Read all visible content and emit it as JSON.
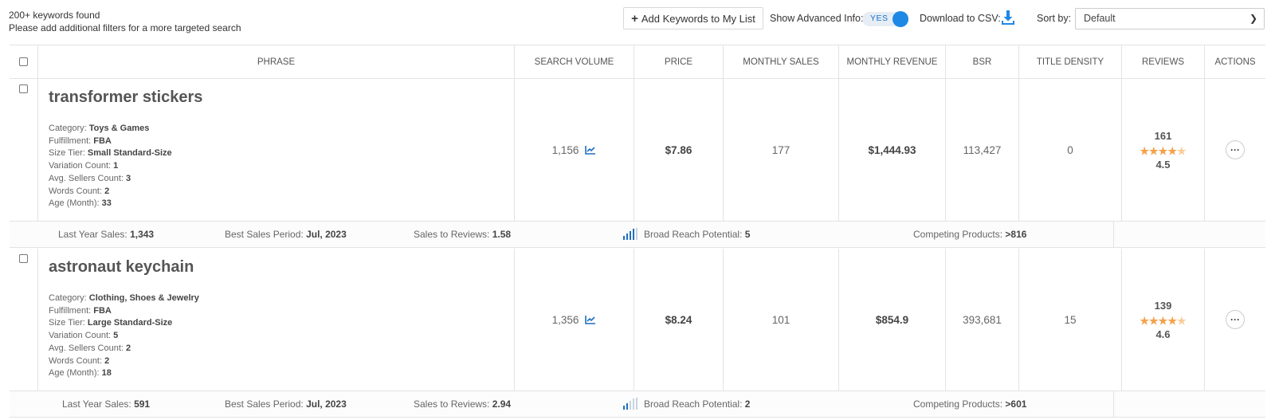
{
  "topbar": {
    "found_line1": "200+ keywords found",
    "found_line2": "Please add additional filters for a more targeted search",
    "add_button": "Add Keywords to My List",
    "advanced_label": "Show Advanced Info:",
    "advanced_toggle": "YES",
    "csv_label": "Download to CSV:",
    "sort_label": "Sort by:",
    "sort_value": "Default"
  },
  "columns": {
    "phrase": "PHRASE",
    "search_volume": "SEARCH VOLUME",
    "price": "PRICE",
    "monthly_sales": "MONTHLY SALES",
    "monthly_revenue": "MONTHLY REVENUE",
    "bsr": "BSR",
    "title_density": "TITLE DENSITY",
    "reviews": "REVIEWS",
    "actions": "ACTIONS"
  },
  "labels": {
    "category": "Category:",
    "fulfillment": "Fulfillment:",
    "size_tier": "Size Tier:",
    "variation_count": "Variation Count:",
    "avg_sellers": "Avg. Sellers Count:",
    "words_count": "Words Count:",
    "age": "Age (Month):",
    "last_year_sales": "Last Year Sales:",
    "best_sales_period": "Best Sales Period:",
    "sales_to_reviews": "Sales to Reviews:",
    "broad_reach": "Broad Reach Potential:",
    "competing": "Competing Products:"
  },
  "rows": [
    {
      "phrase": "transformer stickers",
      "category": "Toys & Games",
      "fulfillment": "FBA",
      "size_tier": "Small Standard-Size",
      "variation_count": "1",
      "avg_sellers": "3",
      "words_count": "2",
      "age": "33",
      "search_volume": "1,156",
      "price": "$7.86",
      "monthly_sales": "177",
      "monthly_revenue": "$1,444.93",
      "bsr": "113,427",
      "title_density": "0",
      "reviews": "161",
      "rating": "4.5",
      "last_year_sales": "1,343",
      "best_sales_period": "Jul, 2023",
      "sales_to_reviews": "1.58",
      "broad_reach": "5",
      "competing": ">816"
    },
    {
      "phrase": "astronaut keychain",
      "category": "Clothing, Shoes & Jewelry",
      "fulfillment": "FBA",
      "size_tier": "Large Standard-Size",
      "variation_count": "5",
      "avg_sellers": "2",
      "words_count": "2",
      "age": "18",
      "search_volume": "1,356",
      "price": "$8.24",
      "monthly_sales": "101",
      "monthly_revenue": "$854.9",
      "bsr": "393,681",
      "title_density": "15",
      "reviews": "139",
      "rating": "4.6",
      "last_year_sales": "591",
      "best_sales_period": "Jul, 2023",
      "sales_to_reviews": "2.94",
      "broad_reach": "2",
      "competing": ">601"
    }
  ],
  "colors": {
    "accent": "#1e88e5",
    "star": "#f5a14b",
    "border": "#e3e3e3"
  }
}
